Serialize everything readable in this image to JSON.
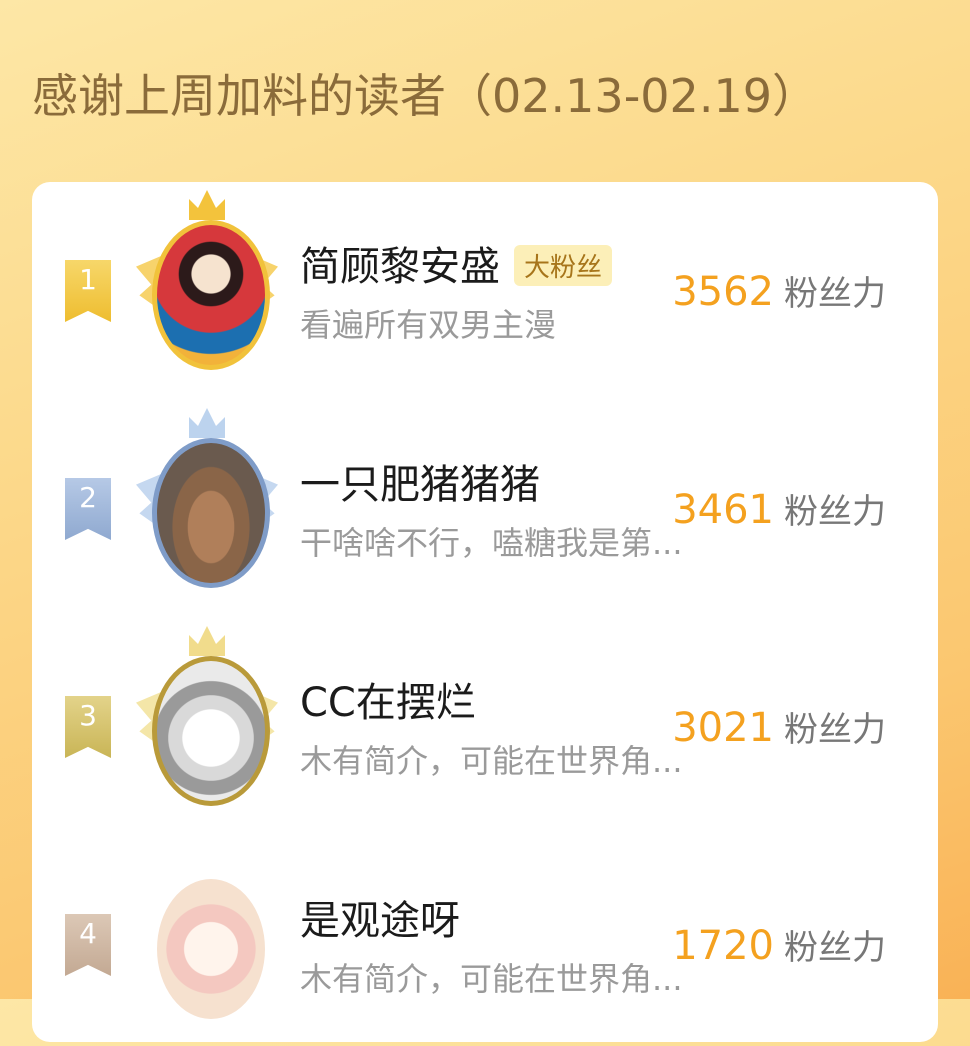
{
  "header": {
    "title": "感谢上周加料的读者（02.13-02.19）"
  },
  "colors": {
    "gold": "#f0c648",
    "silver": "#9db5d6",
    "bronze": "#d8c26b",
    "rank4": "#d6c0ad",
    "score": "#f4a11f"
  },
  "readers": [
    {
      "rank": "1",
      "name": "简顾黎安盛",
      "badge": "大粉丝",
      "desc": "看遍所有双男主漫",
      "score": "3562",
      "unit": "粉丝力"
    },
    {
      "rank": "2",
      "name": "一只肥猪猪猪",
      "desc": "干啥啥不行，嗑糖我是第...",
      "score": "3461",
      "unit": "粉丝力"
    },
    {
      "rank": "3",
      "name": "CC在摆烂",
      "desc": "木有简介，可能在世界角...",
      "score": "3021",
      "unit": "粉丝力"
    },
    {
      "rank": "4",
      "name": "是观途呀",
      "desc": "木有简介，可能在世界角...",
      "score": "1720",
      "unit": "粉丝力"
    }
  ]
}
